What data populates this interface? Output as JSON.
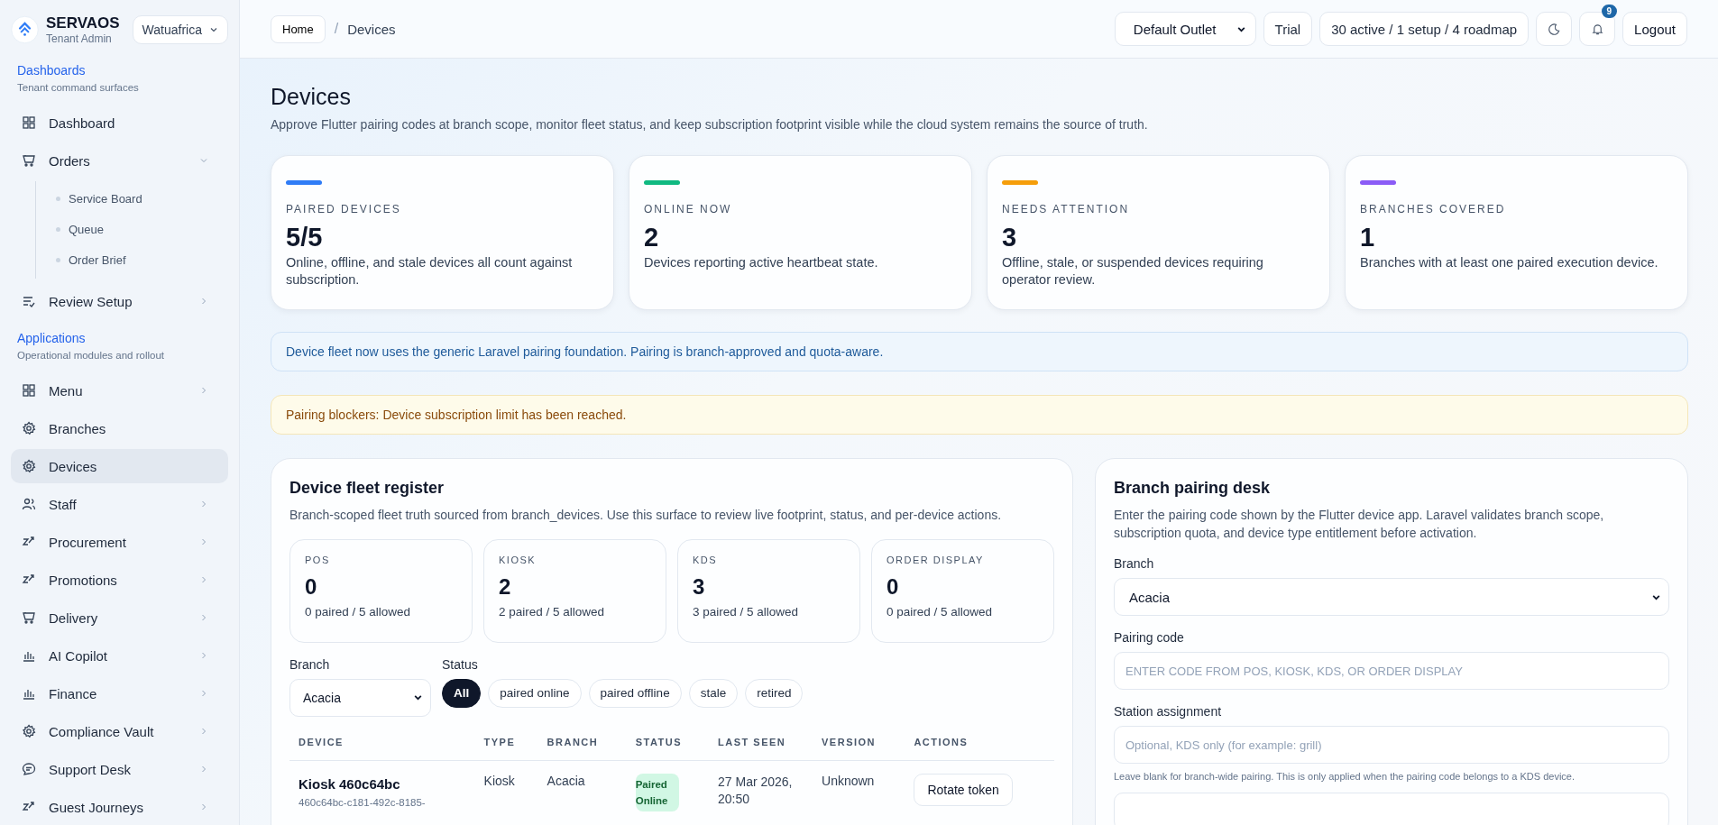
{
  "brand": {
    "name": "SERVAOS",
    "subtitle": "Tenant Admin",
    "tenant": "Watuafrica"
  },
  "sidebar": {
    "sections": [
      {
        "title": "Dashboards",
        "subtitle": "Tenant command surfaces",
        "items": [
          {
            "label": "Dashboard",
            "selected": false
          },
          {
            "label": "Orders",
            "selected": false,
            "expanded": true,
            "children": [
              {
                "label": "Service Board"
              },
              {
                "label": "Queue"
              },
              {
                "label": "Order Brief"
              }
            ]
          },
          {
            "label": "Review Setup",
            "selected": false,
            "expanded": false
          }
        ]
      },
      {
        "title": "Applications",
        "subtitle": "Operational modules and rollout",
        "items": [
          {
            "label": "Menu",
            "selected": false,
            "expanded": false
          },
          {
            "label": "Branches",
            "selected": false
          },
          {
            "label": "Devices",
            "selected": true
          },
          {
            "label": "Staff",
            "selected": false,
            "expanded": false
          },
          {
            "label": "Procurement",
            "selected": false,
            "expanded": false
          },
          {
            "label": "Promotions",
            "selected": false,
            "expanded": false
          },
          {
            "label": "Delivery",
            "selected": false,
            "expanded": false
          },
          {
            "label": "AI Copilot",
            "selected": false,
            "expanded": false
          },
          {
            "label": "Finance",
            "selected": false,
            "expanded": false
          },
          {
            "label": "Compliance Vault",
            "selected": false,
            "expanded": false
          },
          {
            "label": "Support Desk",
            "selected": false,
            "expanded": false
          },
          {
            "label": "Guest Journeys",
            "selected": false,
            "expanded": false
          }
        ]
      }
    ]
  },
  "breadcrumb": {
    "home": "Home",
    "separator": "/",
    "current": "Devices"
  },
  "topbar": {
    "outlet": "Default Outlet",
    "plan": "Trial",
    "modules": "30 active / 1 setup / 4 roadmap",
    "notifications": "9",
    "logout": "Logout"
  },
  "page": {
    "title": "Devices",
    "subtitle": "Approve Flutter pairing codes at branch scope, monitor fleet status, and keep subscription footprint visible while the cloud system remains the source of truth."
  },
  "stats": [
    {
      "label": "PAIRED DEVICES",
      "value": "5/5",
      "description": "Online, offline, and stale devices all count against subscription.",
      "color": "#2f7cf6"
    },
    {
      "label": "ONLINE NOW",
      "value": "2",
      "description": "Devices reporting active heartbeat state.",
      "color": "#10b981"
    },
    {
      "label": "NEEDS ATTENTION",
      "value": "3",
      "description": "Offline, stale, or suspended devices requiring operator review.",
      "color": "#f59e0b"
    },
    {
      "label": "BRANCHES COVERED",
      "value": "1",
      "description": "Branches with at least one paired execution device.",
      "color": "#8b5cf6"
    }
  ],
  "notices": [
    {
      "kind": "info",
      "text": "Device fleet now uses the generic Laravel pairing foundation. Pairing is branch-approved and quota-aware."
    },
    {
      "kind": "warning",
      "text": "Pairing blockers: Device subscription limit has been reached."
    }
  ],
  "register": {
    "title": "Device fleet register",
    "subtitle": "Branch-scoped fleet truth sourced from branch_devices. Use this surface to review live footprint, status, and per-device actions.",
    "types": [
      {
        "label": "POS",
        "value": "0",
        "caption": "0 paired / 5 allowed"
      },
      {
        "label": "KIOSK",
        "value": "2",
        "caption": "2 paired / 5 allowed"
      },
      {
        "label": "KDS",
        "value": "3",
        "caption": "3 paired / 5 allowed"
      },
      {
        "label": "ORDER DISPLAY",
        "value": "0",
        "caption": "0 paired / 5 allowed"
      }
    ],
    "branch_label": "Branch",
    "branch_value": "Acacia",
    "status_label": "Status",
    "status_filters": [
      {
        "label": "All",
        "selected": true
      },
      {
        "label": "paired online",
        "selected": false
      },
      {
        "label": "paired offline",
        "selected": false
      },
      {
        "label": "stale",
        "selected": false
      },
      {
        "label": "retired",
        "selected": false
      }
    ],
    "table": {
      "columns": [
        "DEVICE",
        "TYPE",
        "BRANCH",
        "STATUS",
        "LAST SEEN",
        "VERSION",
        "ACTIONS"
      ],
      "rows": [
        {
          "device": "Kiosk 460c64bc",
          "device_id": "460c64bc-c181-492c-8185-",
          "type": "Kiosk",
          "branch": "Acacia",
          "status": {
            "label": "Paired Online",
            "kind": "online"
          },
          "last_seen": "27 Mar 2026, 20:50",
          "version": "Unknown",
          "action": "Rotate token"
        }
      ]
    }
  },
  "pairing": {
    "title": "Branch pairing desk",
    "subtitle": "Enter the pairing code shown by the Flutter device app. Laravel validates branch scope, subscription quota, and device type entitlement before activation.",
    "branch_label": "Branch",
    "branch_value": "Acacia",
    "code_label": "Pairing code",
    "code_placeholder": "ENTER CODE FROM POS, KIOSK, KDS, OR ORDER DISPLAY",
    "station_label": "Station assignment",
    "station_placeholder": "Optional, KDS only (for example: grill)",
    "station_hint": "Leave blank for branch-wide pairing. This is only applied when the pairing code belongs to a KDS device."
  }
}
